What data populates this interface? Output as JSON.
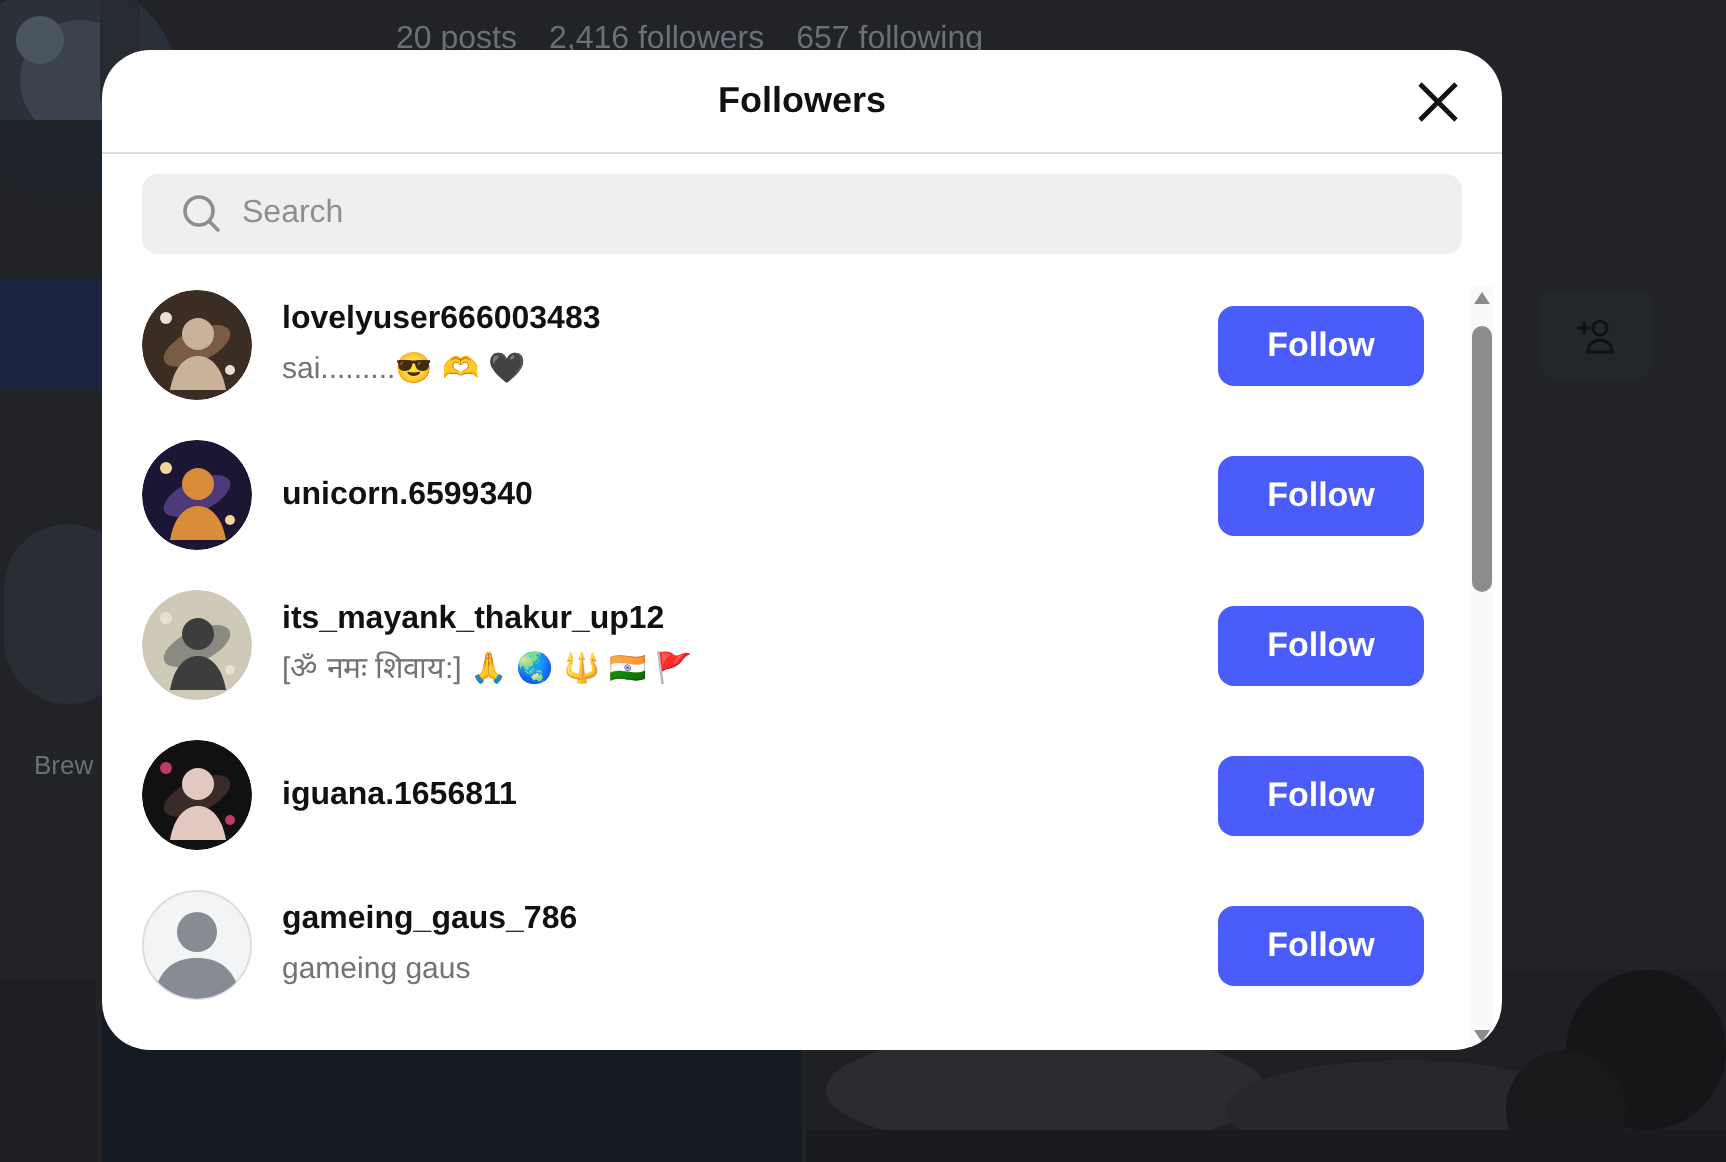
{
  "background": {
    "stats": [
      "20 posts",
      "2,416 followers",
      "657 following"
    ],
    "highlight_label": "Brew"
  },
  "dialog": {
    "title": "Followers",
    "search": {
      "placeholder": "Search"
    },
    "followers": [
      {
        "username": "lovelyuser666003483",
        "bio": "sai.........😎 🫶 🖤",
        "button": "Follow"
      },
      {
        "username": "unicorn.6599340",
        "button": "Follow"
      },
      {
        "username": "its_mayank_thakur_up12",
        "bio": "[ॐ नमः शिवाय:]  🙏 🌏 🔱 🇮🇳 🚩",
        "button": "Follow"
      },
      {
        "username": "iguana.1656811",
        "button": "Follow"
      },
      {
        "username": "gameing_gaus_786",
        "bio": "gameing gaus",
        "avatar": {
          "kind": "default"
        },
        "button": "Follow"
      }
    ]
  }
}
